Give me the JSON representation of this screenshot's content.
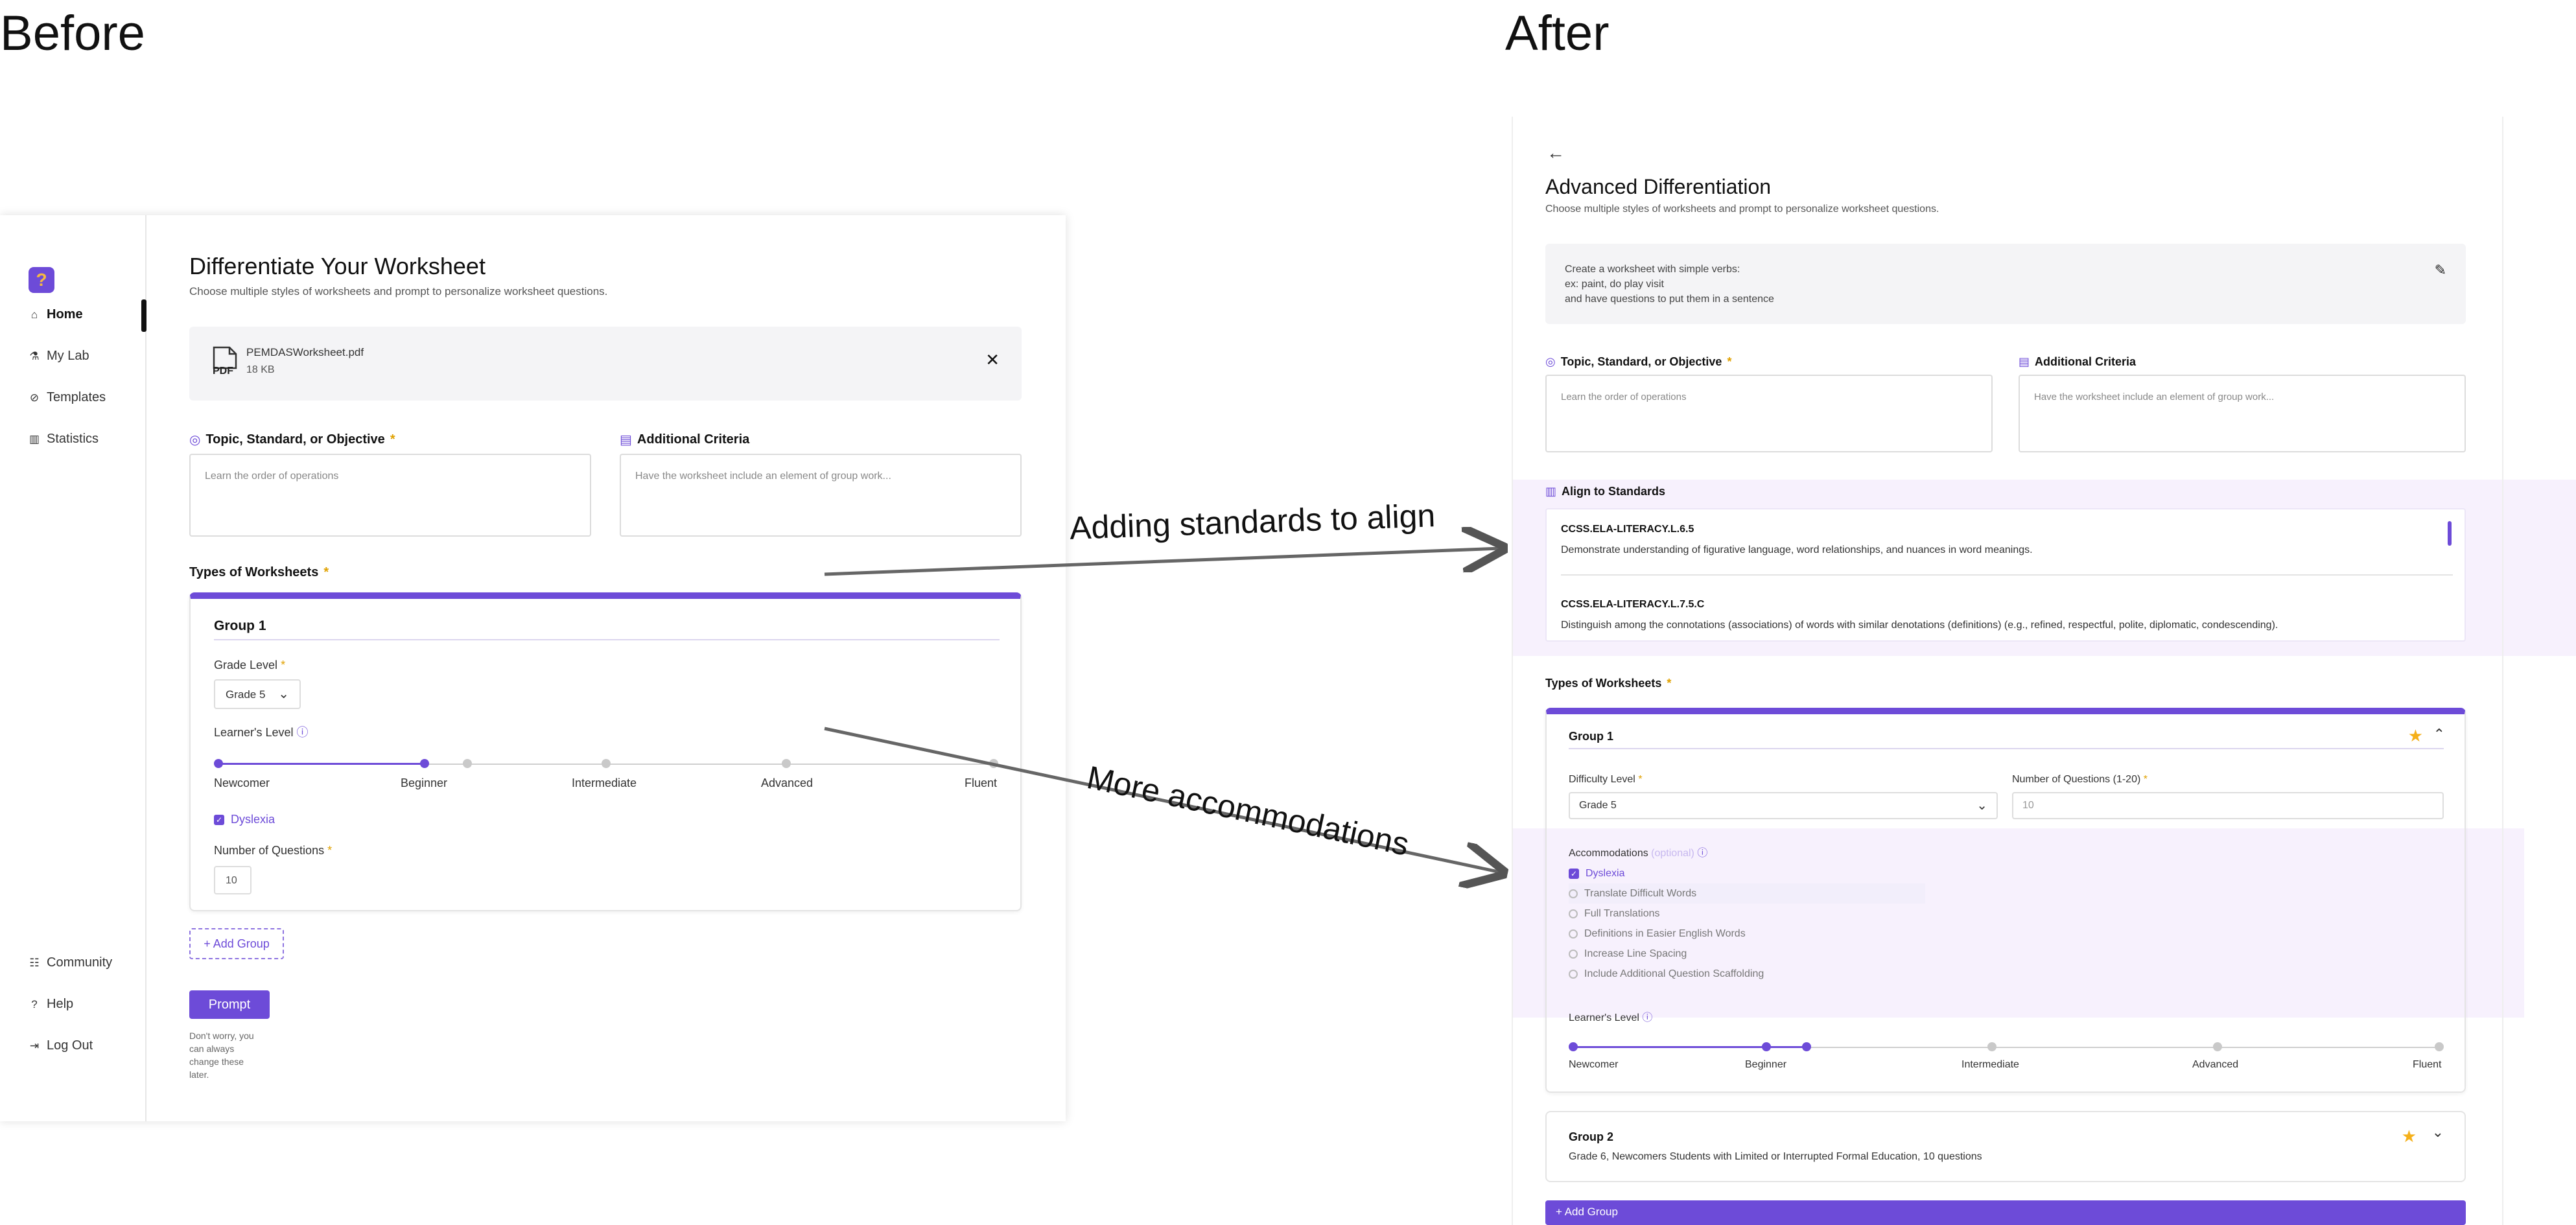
{
  "headlines": {
    "before": "Before",
    "after": "After"
  },
  "annotations": {
    "standards": "Adding standards to align",
    "accommodations": "More accommodations"
  },
  "before": {
    "sidebar": {
      "items": [
        {
          "label": "Home",
          "icon": "home-icon",
          "active": true
        },
        {
          "label": "My Lab",
          "icon": "lab-icon"
        },
        {
          "label": "Templates",
          "icon": "templates-icon"
        },
        {
          "label": "Statistics",
          "icon": "chart-icon"
        }
      ],
      "bottom_items": [
        {
          "label": "Community",
          "icon": "people-icon"
        },
        {
          "label": "Help",
          "icon": "help-icon"
        },
        {
          "label": "Log Out",
          "icon": "logout-icon"
        }
      ]
    },
    "page_title": "Differentiate Your Worksheet",
    "page_subtitle": "Choose multiple styles of worksheets and prompt to personalize worksheet questions.",
    "file": {
      "type": "PDF",
      "name": "PEMDASWorksheet.pdf",
      "size": "18 KB"
    },
    "topic_label": "Topic, Standard, or Objective",
    "topic_placeholder": "Learn the order of operations",
    "criteria_label": "Additional Criteria",
    "criteria_placeholder": "Have the worksheet include an element of group work...",
    "types_label": "Types of Worksheets",
    "group": {
      "title": "Group 1",
      "grade_label": "Grade Level",
      "grade_value": "Grade 5",
      "learner_label": "Learner's Level",
      "levels": [
        "Newcomer",
        "Beginner",
        "Intermediate",
        "Advanced",
        "Fluent"
      ],
      "selected_level_fraction": 0.25,
      "accommodation": "Dyslexia",
      "questions_label": "Number of Questions",
      "questions_value": "10"
    },
    "add_group": "+ Add Group",
    "prompt_button": "Prompt",
    "note": [
      "Don't worry, you",
      "can always",
      "change these",
      "later."
    ]
  },
  "after": {
    "page_title": "Advanced Differentiation",
    "page_subtitle": "Choose multiple styles of worksheets and prompt to personalize worksheet questions.",
    "prompt_lines": [
      "Create a worksheet with simple verbs:",
      "ex: paint, do play visit",
      "and have questions to put them in a sentence"
    ],
    "topic_label": "Topic, Standard, or Objective",
    "topic_placeholder": "Learn the order of operations",
    "criteria_label": "Additional Criteria",
    "criteria_placeholder": "Have the worksheet include an element of group work...",
    "standards_label": "Align to Standards",
    "standards": [
      {
        "code": "CCSS.ELA-LITERACY.L.6.5",
        "desc": "Demonstrate understanding of figurative language, word relationships, and nuances in word meanings."
      },
      {
        "code": "CCSS.ELA-LITERACY.L.7.5.C",
        "desc": "Distinguish among the connotations (associations) of words with similar denotations (definitions) (e.g., refined, respectful, polite, diplomatic, condescending)."
      }
    ],
    "types_label": "Types of Worksheets",
    "group1": {
      "title": "Group 1",
      "difficulty_label": "Difficulty Level",
      "difficulty_value": "Grade 5",
      "questions_label": "Number of Questions (1-20)",
      "questions_value": "10",
      "accommodations_label": "Accommodations",
      "optional": "(optional)",
      "accommodations": [
        {
          "label": "Dyslexia",
          "checked": true
        },
        {
          "label": "Translate Difficult Words",
          "checked": false
        },
        {
          "label": "Full Translations",
          "checked": false
        },
        {
          "label": "Definitions in Easier English Words",
          "checked": false
        },
        {
          "label": "Increase Line Spacing",
          "checked": false
        },
        {
          "label": "Include Additional Question Scaffolding",
          "checked": false
        }
      ],
      "learner_label": "Learner's Level",
      "levels": [
        "Newcomer",
        "Beginner",
        "Intermediate",
        "Advanced",
        "Fluent"
      ]
    },
    "group2": {
      "title": "Group 2",
      "summary": "Grade 6, Newcomers Students with Limited or Interrupted Formal Education, 10 questions"
    },
    "add_group": "+ Add Group"
  },
  "colors": {
    "accent": "#6d4bd8",
    "star": "#f5b01a",
    "highlight": "#f7f1fd"
  }
}
